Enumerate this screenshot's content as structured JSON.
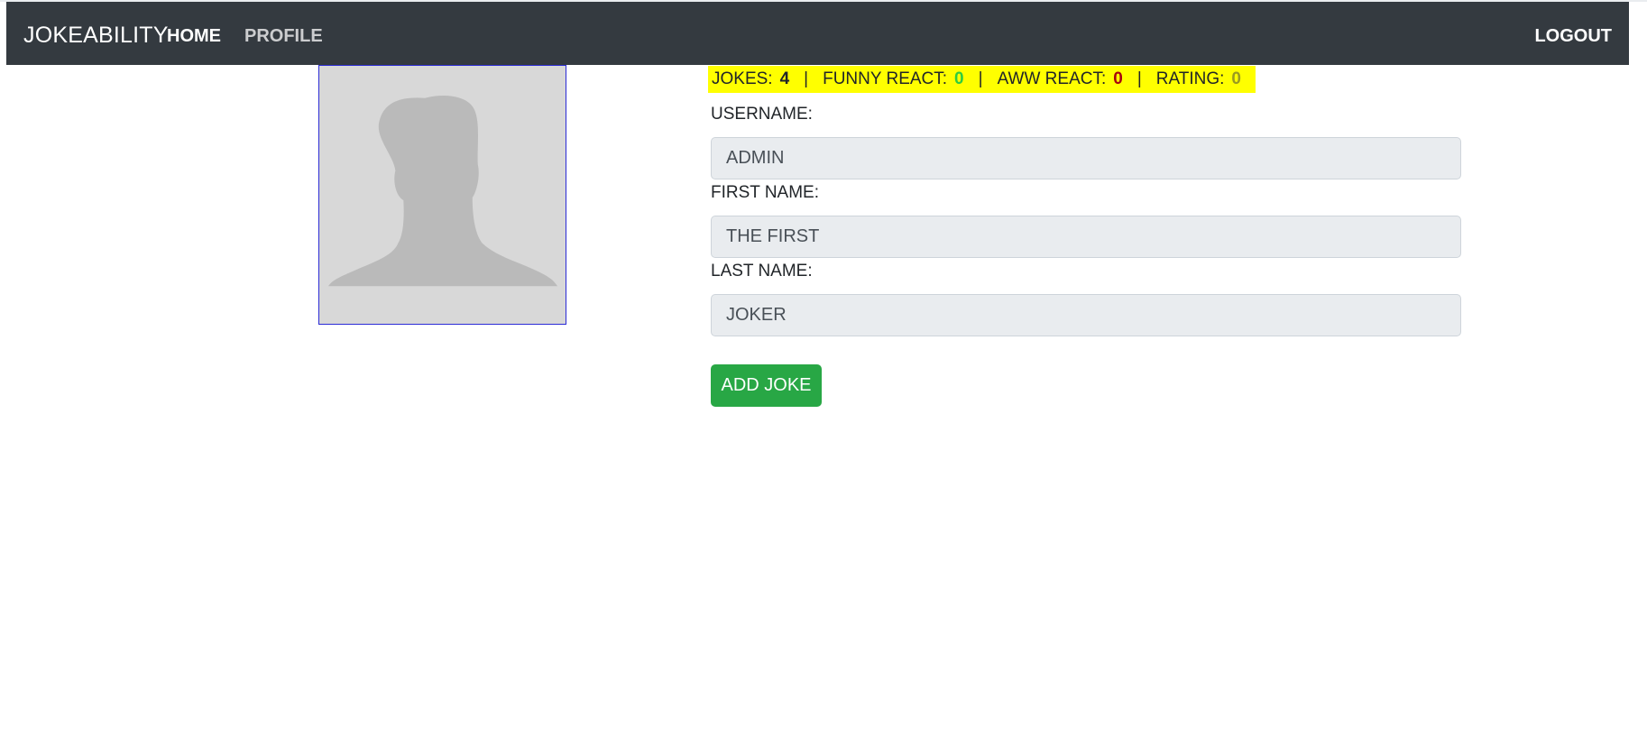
{
  "nav": {
    "brand": "JOKEABILITY",
    "home": "HOME",
    "profile": "PROFILE",
    "logout": "LOGOUT"
  },
  "stats": {
    "jokes_label": "JOKES:",
    "jokes_value": "4",
    "funny_label": "FUNNY REACT:",
    "funny_value": "0",
    "aww_label": "AWW REACT:",
    "aww_value": "0",
    "rating_label": "RATING:",
    "rating_value": "0",
    "separator": "|",
    "highlight_color": "#ffff00",
    "funny_color": "#2ecc40",
    "aww_color": "#a8000e",
    "rating_color": "#9a9a20"
  },
  "profile": {
    "avatar_icon": "user-silhouette-icon",
    "username_label": "USERNAME:",
    "username_value": "ADMIN",
    "firstname_label": "FIRST NAME:",
    "firstname_value": "THE FIRST",
    "lastname_label": "LAST NAME:",
    "lastname_value": "JOKER"
  },
  "actions": {
    "add_joke": "ADD JOKE",
    "button_color": "#28a745"
  }
}
